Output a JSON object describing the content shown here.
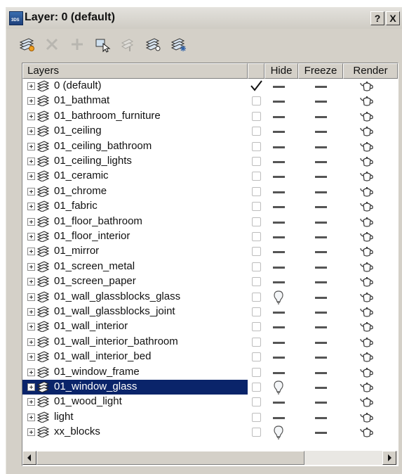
{
  "window": {
    "title": "Layer: 0 (default)",
    "app_icon_text": "3DS",
    "help_button": "?",
    "close_button": "X"
  },
  "toolbar": {
    "buttons": [
      {
        "name": "create-new-layer-icon",
        "enabled": true
      },
      {
        "name": "delete-layer-icon",
        "enabled": false
      },
      {
        "name": "add-to-layer-icon",
        "enabled": false
      },
      {
        "name": "select-objects-icon",
        "enabled": true
      },
      {
        "name": "highlight-selected-icon",
        "enabled": false
      },
      {
        "name": "hide-unhide-all-icon",
        "enabled": true
      },
      {
        "name": "freeze-unfreeze-all-icon",
        "enabled": true
      }
    ]
  },
  "columns": {
    "layers": "Layers",
    "hide": "Hide",
    "freeze": "Freeze",
    "render": "Render"
  },
  "layers": [
    {
      "name": "0 (default)",
      "active": true,
      "hidden": false,
      "frozen": false,
      "renderable": true,
      "selected": false
    },
    {
      "name": "01_bathmat",
      "active": false,
      "hidden": false,
      "frozen": false,
      "renderable": true,
      "selected": false
    },
    {
      "name": "01_bathroom_furniture",
      "active": false,
      "hidden": false,
      "frozen": false,
      "renderable": true,
      "selected": false
    },
    {
      "name": "01_ceiling",
      "active": false,
      "hidden": false,
      "frozen": false,
      "renderable": true,
      "selected": false
    },
    {
      "name": "01_ceiling_bathroom",
      "active": false,
      "hidden": false,
      "frozen": false,
      "renderable": true,
      "selected": false
    },
    {
      "name": "01_ceiling_lights",
      "active": false,
      "hidden": false,
      "frozen": false,
      "renderable": true,
      "selected": false
    },
    {
      "name": "01_ceramic",
      "active": false,
      "hidden": false,
      "frozen": false,
      "renderable": true,
      "selected": false
    },
    {
      "name": "01_chrome",
      "active": false,
      "hidden": false,
      "frozen": false,
      "renderable": true,
      "selected": false
    },
    {
      "name": "01_fabric",
      "active": false,
      "hidden": false,
      "frozen": false,
      "renderable": true,
      "selected": false
    },
    {
      "name": "01_floor_bathroom",
      "active": false,
      "hidden": false,
      "frozen": false,
      "renderable": true,
      "selected": false
    },
    {
      "name": "01_floor_interior",
      "active": false,
      "hidden": false,
      "frozen": false,
      "renderable": true,
      "selected": false
    },
    {
      "name": "01_mirror",
      "active": false,
      "hidden": false,
      "frozen": false,
      "renderable": true,
      "selected": false
    },
    {
      "name": "01_screen_metal",
      "active": false,
      "hidden": false,
      "frozen": false,
      "renderable": true,
      "selected": false
    },
    {
      "name": "01_screen_paper",
      "active": false,
      "hidden": false,
      "frozen": false,
      "renderable": true,
      "selected": false
    },
    {
      "name": "01_wall_glassblocks_glass",
      "active": false,
      "hidden": true,
      "frozen": false,
      "renderable": true,
      "selected": false
    },
    {
      "name": "01_wall_glassblocks_joint",
      "active": false,
      "hidden": false,
      "frozen": false,
      "renderable": true,
      "selected": false
    },
    {
      "name": "01_wall_interior",
      "active": false,
      "hidden": false,
      "frozen": false,
      "renderable": true,
      "selected": false
    },
    {
      "name": "01_wall_interior_bathroom",
      "active": false,
      "hidden": false,
      "frozen": false,
      "renderable": true,
      "selected": false
    },
    {
      "name": "01_wall_interior_bed",
      "active": false,
      "hidden": false,
      "frozen": false,
      "renderable": true,
      "selected": false
    },
    {
      "name": "01_window_frame",
      "active": false,
      "hidden": false,
      "frozen": false,
      "renderable": true,
      "selected": false
    },
    {
      "name": "01_window_glass",
      "active": false,
      "hidden": true,
      "frozen": false,
      "renderable": true,
      "selected": true
    },
    {
      "name": "01_wood_light",
      "active": false,
      "hidden": false,
      "frozen": false,
      "renderable": true,
      "selected": false
    },
    {
      "name": "light",
      "active": false,
      "hidden": false,
      "frozen": false,
      "renderable": true,
      "selected": false
    },
    {
      "name": "xx_blocks",
      "active": false,
      "hidden": true,
      "frozen": false,
      "renderable": true,
      "selected": false
    }
  ],
  "colors": {
    "selection": "#0a246a",
    "panel": "#d4d0c8",
    "list_background": "#ffffff"
  }
}
